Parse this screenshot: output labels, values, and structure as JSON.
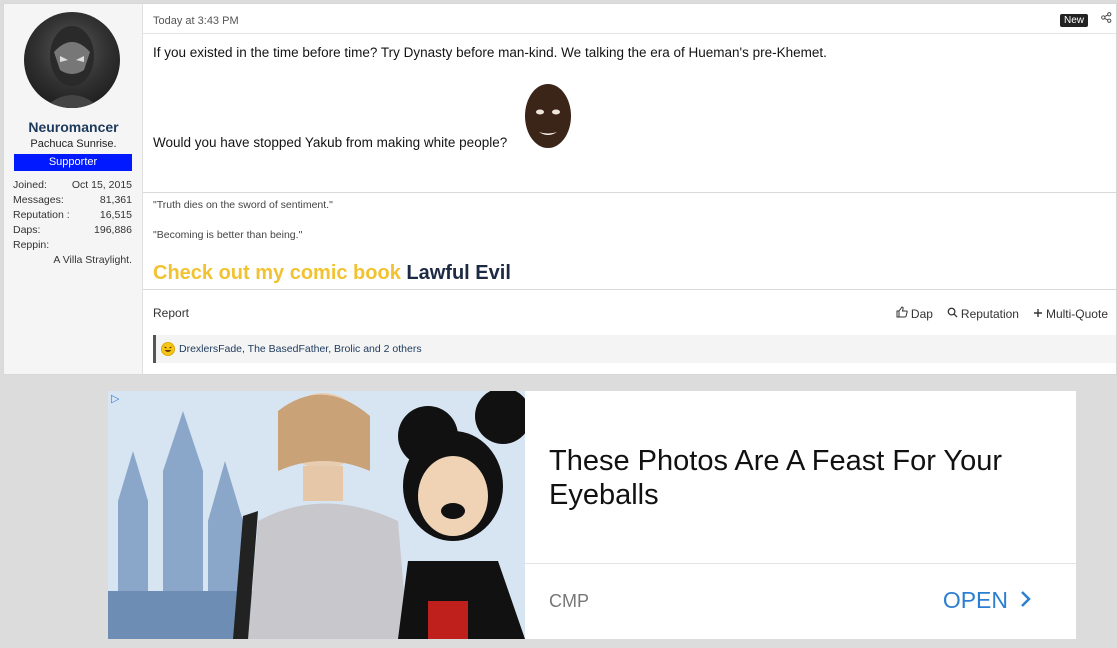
{
  "post": {
    "timestamp": "Today at 3:43 PM",
    "new_badge": "New",
    "user": {
      "name": "Neuromancer",
      "title": "Pachuca Sunrise.",
      "badge": "Supporter",
      "stats": [
        {
          "label": "Joined:",
          "value": "Oct 15, 2015"
        },
        {
          "label": "Messages:",
          "value": "81,361"
        },
        {
          "label": "Reputation :",
          "value": "16,515"
        },
        {
          "label": "Daps:",
          "value": "196,886"
        }
      ],
      "reppin_label": "Reppin:",
      "reppin_value": "A Villa Straylight."
    },
    "body": {
      "line1": "If you existed in the time before time? Try Dynasty before man-kind. We talking the era of Hueman's pre-Khemet.",
      "line2": "Would you have stopped Yakub from making white people?"
    },
    "signature": {
      "quote1": "\"Truth dies on the sword of sentiment.\"",
      "quote2": "\"Becoming is better than being.\"",
      "comic_prefix": "Check out my comic book",
      "comic_link": "Lawful Evil"
    },
    "actions": {
      "report": "Report",
      "dap": "Dap",
      "reputation": "Reputation",
      "multiquote": "Multi-Quote"
    },
    "reactions": "DrexlersFade, The BasedFather, Brolic and 2 others"
  },
  "ad": {
    "headline": "These Photos Are A Feast For Your Eyeballs",
    "source": "CMP",
    "cta": "OPEN"
  }
}
